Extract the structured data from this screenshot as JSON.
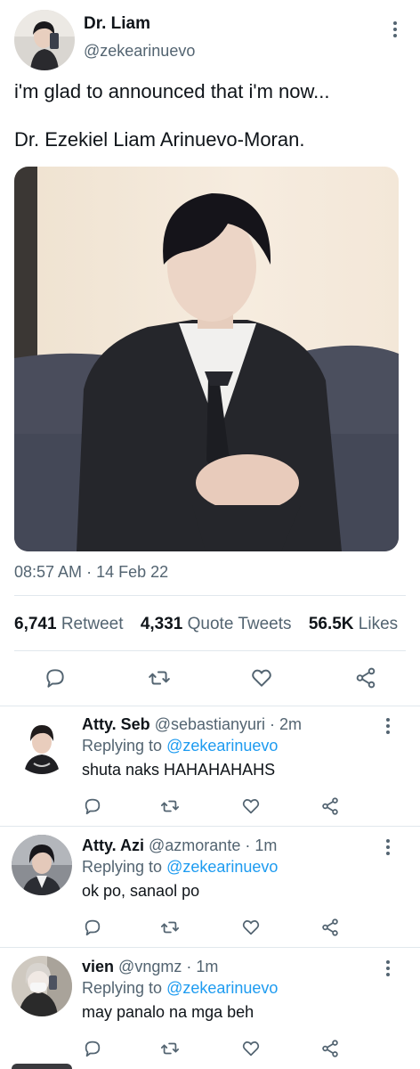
{
  "tweet": {
    "author_name": "Dr. Liam",
    "author_handle": "@zekearinuevo",
    "text_line1": "i'm glad to announced that i'm now...",
    "text_line2": "Dr. Ezekiel Liam Arinuevo-Moran.",
    "time": "08:57 AM",
    "date": "14 Feb 22",
    "separator": " · ",
    "stats": {
      "retweets_count": "6,741",
      "retweets_label": "Retweet",
      "quotes_count": "4,331",
      "quotes_label": "Quote Tweets",
      "likes_count": "56.5K",
      "likes_label": "Likes"
    },
    "actions": [
      "reply-icon",
      "retweet-icon",
      "like-icon",
      "share-icon"
    ]
  },
  "replies": [
    {
      "name": "Atty. Seb",
      "handle": "@sebastianyuri",
      "time": "2m",
      "replying_prefix": "Replying to",
      "replying_to": "@zekearinuevo",
      "text": "shuta naks HAHAHAHAHS"
    },
    {
      "name": "Atty. Azi",
      "handle": "@azmorante",
      "time": "1m",
      "replying_prefix": "Replying to",
      "replying_to": "@zekearinuevo",
      "text": "ok po, sanaol po"
    },
    {
      "name": "vien",
      "handle": "@vngmz",
      "time": "1m",
      "replying_prefix": "Replying to",
      "replying_to": "@zekearinuevo",
      "text": "may panalo na mga beh"
    }
  ],
  "colors": {
    "text": "#0f1419",
    "secondary": "#536471",
    "link": "#1d9bf0",
    "divider": "#e1e8ed"
  }
}
